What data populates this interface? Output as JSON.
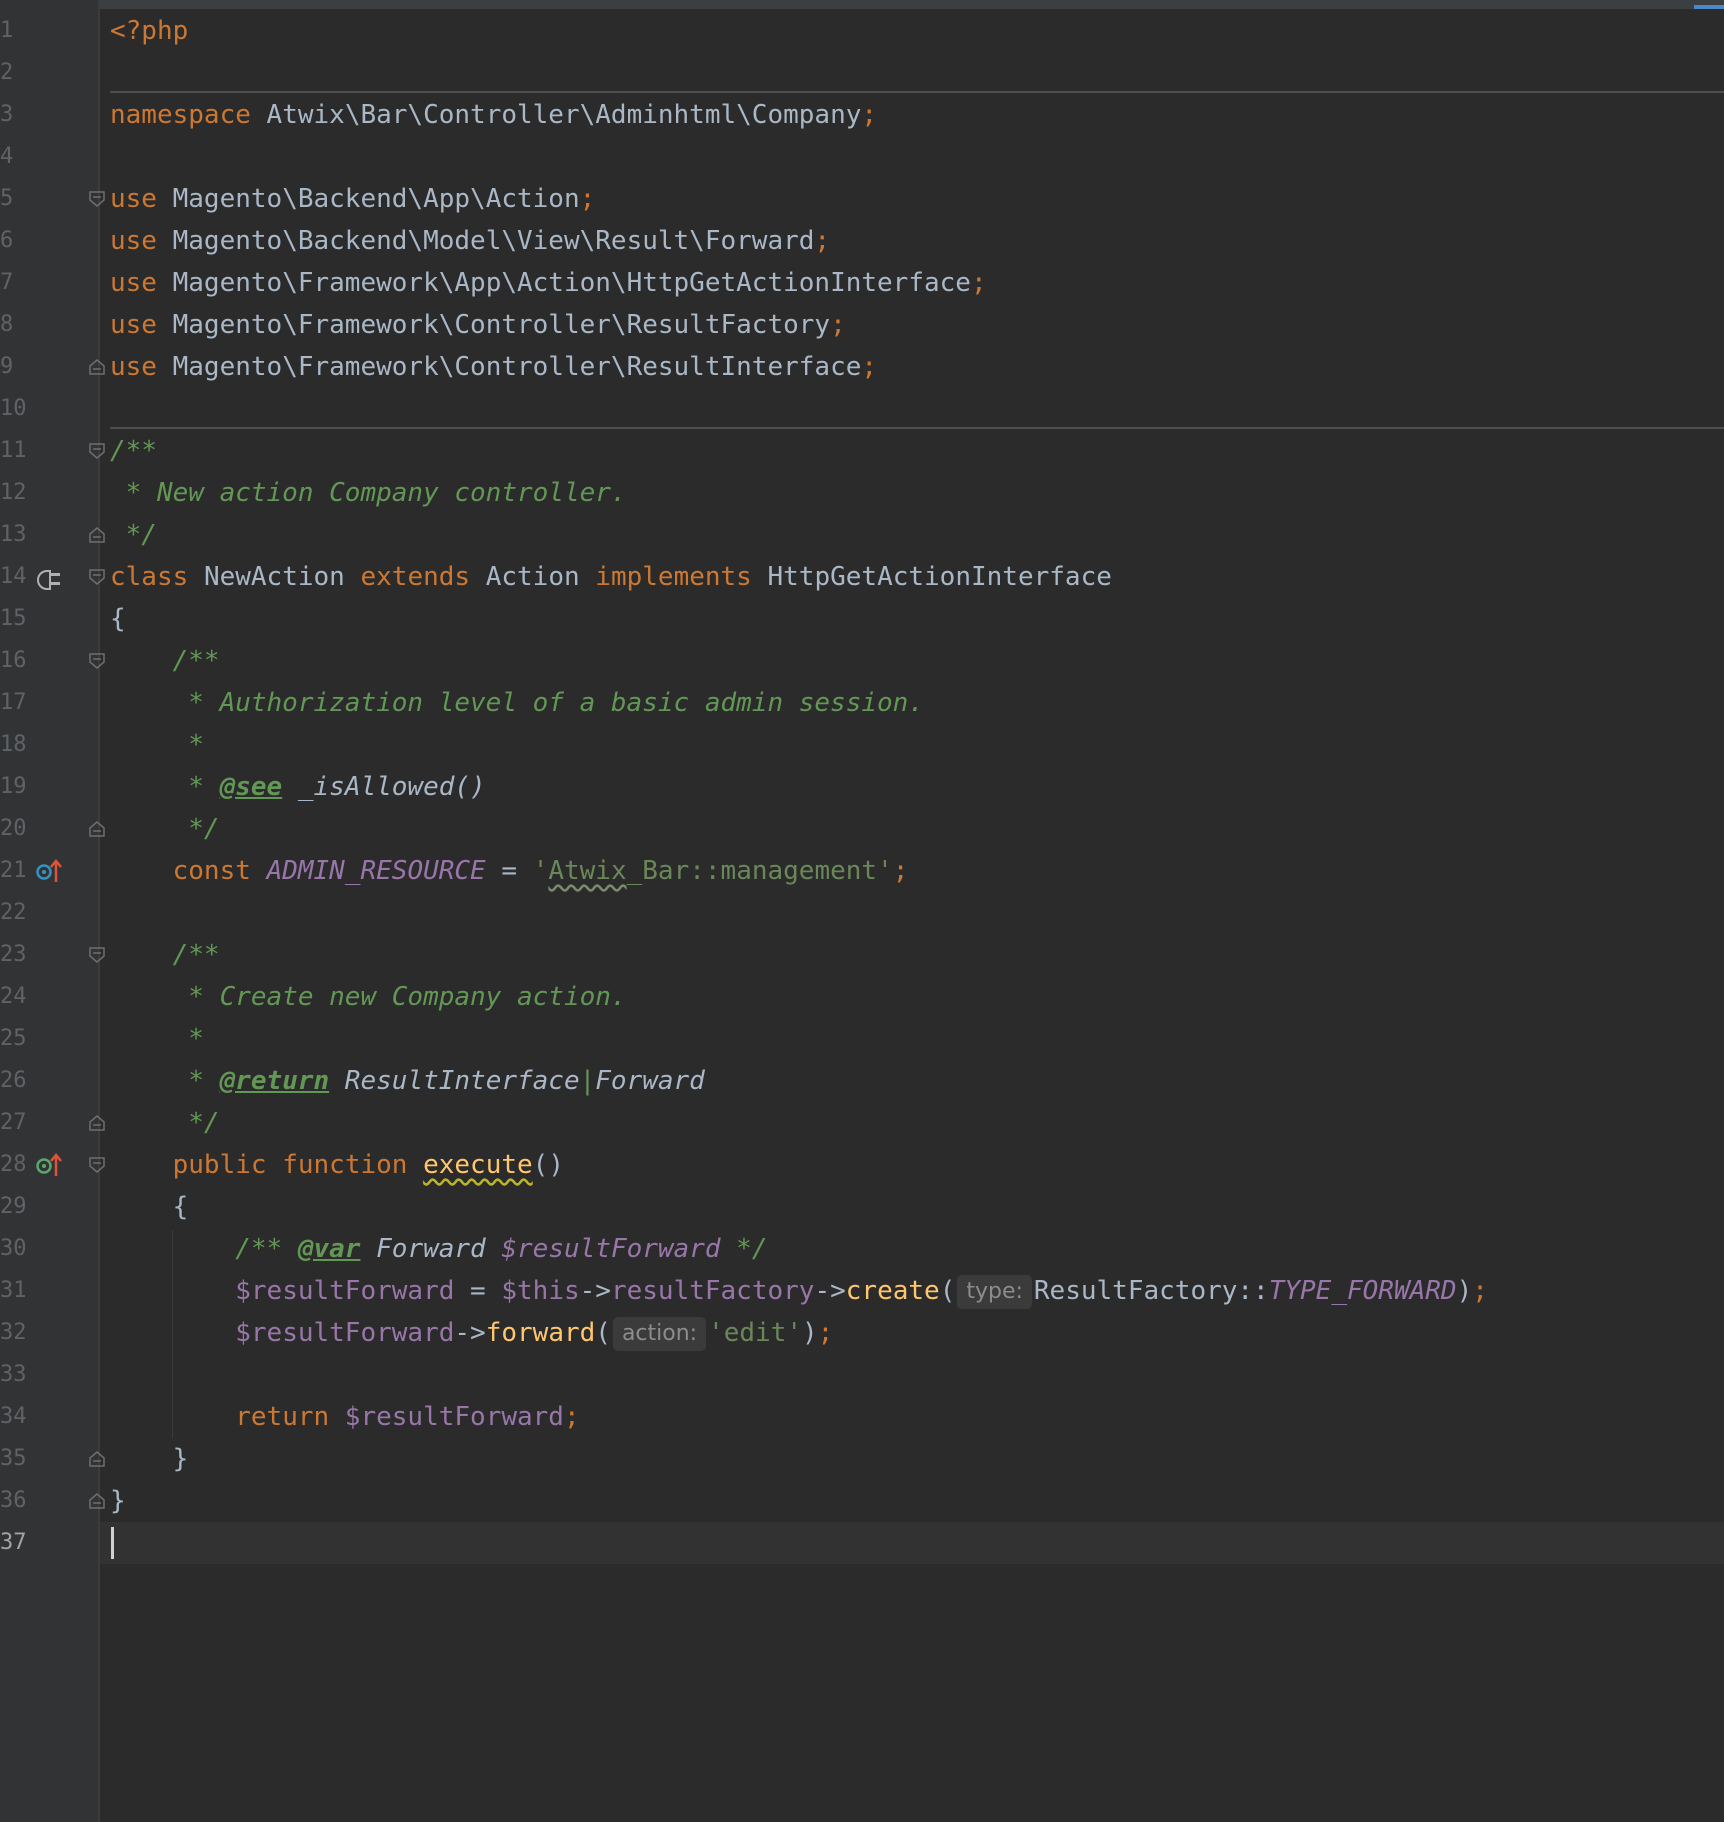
{
  "editor": {
    "language": "php",
    "current_line": 37
  },
  "gutter": {
    "line_numbers": [
      "1",
      "2",
      "3",
      "4",
      "5",
      "6",
      "7",
      "8",
      "9",
      "10",
      "11",
      "12",
      "13",
      "14",
      "15",
      "16",
      "17",
      "18",
      "19",
      "20",
      "21",
      "22",
      "23",
      "24",
      "25",
      "26",
      "27",
      "28",
      "29",
      "30",
      "31",
      "32",
      "33",
      "34",
      "35",
      "36",
      "37"
    ],
    "icons": [
      {
        "line": 14,
        "name": "implemented-interface-icon"
      },
      {
        "line": 21,
        "name": "overrides-constant-icon"
      },
      {
        "line": 28,
        "name": "implements-method-icon"
      }
    ]
  },
  "code": {
    "l1": {
      "open_tag": "<?php"
    },
    "l3": {
      "kw": "namespace",
      "path": "Atwix\\Bar\\Controller\\Adminhtml\\Company",
      "semi": ";"
    },
    "uses": [
      {
        "kw": "use",
        "path": "Magento\\Backend\\App\\Action",
        "semi": ";"
      },
      {
        "kw": "use",
        "path": "Magento\\Backend\\Model\\View\\Result\\Forward",
        "semi": ";"
      },
      {
        "kw": "use",
        "path": "Magento\\Framework\\App\\Action\\HttpGetActionInterface",
        "semi": ";"
      },
      {
        "kw": "use",
        "path": "Magento\\Framework\\Controller\\ResultFactory",
        "semi": ";"
      },
      {
        "kw": "use",
        "path": "Magento\\Framework\\Controller\\ResultInterface",
        "semi": ";"
      }
    ],
    "l11": "/**",
    "l12": " * New action Company controller.",
    "l13": " */",
    "l14": {
      "kw_class": "class",
      "name": "NewAction",
      "kw_extends": "extends",
      "parent": "Action",
      "kw_implements": "implements",
      "iface": "HttpGetActionInterface"
    },
    "l15": "{",
    "l16": "    /**",
    "l17": "     * Authorization level of a basic admin session.",
    "l18": "     *",
    "l19": {
      "prefix": "     * ",
      "tag": "@see",
      "rest": " _isAllowed()"
    },
    "l20": "     */",
    "l21": {
      "indent": "    ",
      "kw": "const",
      "name": "ADMIN_RESOURCE",
      "eq": " = ",
      "str_open": "'",
      "str_sq": "Atwix",
      "str_rest": "_Bar::management'",
      "semi": ";"
    },
    "l23": "    /**",
    "l24": "     * Create new Company action.",
    "l25": "     *",
    "l26": {
      "prefix": "     * ",
      "tag": "@return",
      "type1": " ResultInterface",
      "pipe": "|",
      "type2": "Forward"
    },
    "l27": "     */",
    "l28": {
      "indent": "    ",
      "kw1": "public",
      "kw2": "function",
      "name": "execute",
      "parens": "()"
    },
    "l29": "    {",
    "l30": {
      "indent": "        ",
      "open": "/** ",
      "tag": "@var",
      "type": " Forward ",
      "var": "$resultForward",
      "close": " */"
    },
    "l31": {
      "indent": "        ",
      "var": "$resultForward",
      "eq": " = ",
      "this": "$this",
      "arrow1": "->",
      "prop": "resultFactory",
      "arrow2": "->",
      "fn": "create",
      "open": "(",
      "hint": "type:",
      "cls": "ResultFactory",
      "dc": "::",
      "const": "TYPE_FORWARD",
      "close": ")",
      "semi": ";"
    },
    "l32": {
      "indent": "        ",
      "var": "$resultForward",
      "arrow": "->",
      "fn": "forward",
      "open": "(",
      "hint": "action:",
      "str": "'edit'",
      "close": ")",
      "semi": ";"
    },
    "l34": {
      "indent": "        ",
      "kw": "return",
      "var": " $resultForward",
      "semi": ";"
    },
    "l35": "    }",
    "l36": "}"
  }
}
